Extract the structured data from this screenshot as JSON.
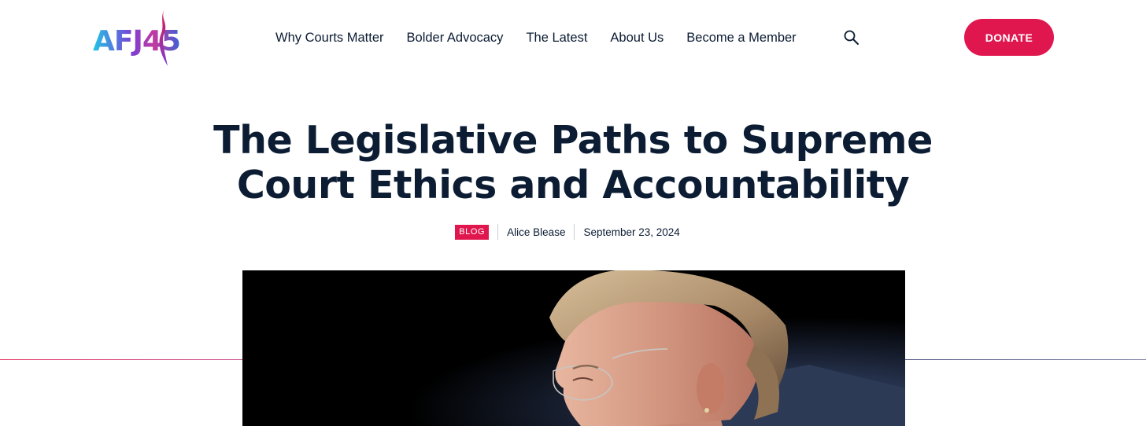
{
  "header": {
    "logo_text": "AFJ45",
    "nav": [
      {
        "label": "Why Courts Matter"
      },
      {
        "label": "Bolder Advocacy"
      },
      {
        "label": "The Latest"
      },
      {
        "label": "About Us"
      },
      {
        "label": "Become a Member"
      }
    ],
    "search_icon": "search-icon",
    "donate_label": "DONATE"
  },
  "article": {
    "title_line1": "The Legislative Paths to Supreme",
    "title_line2": "Court Ethics and Accountability",
    "category": "BLOG",
    "author": "Alice Blease",
    "date": "September 23, 2024"
  },
  "colors": {
    "accent": "#e0174f",
    "text": "#0b1c33",
    "logo_gradient": [
      "#22c4e6",
      "#7a3fd6",
      "#e0174f"
    ]
  }
}
